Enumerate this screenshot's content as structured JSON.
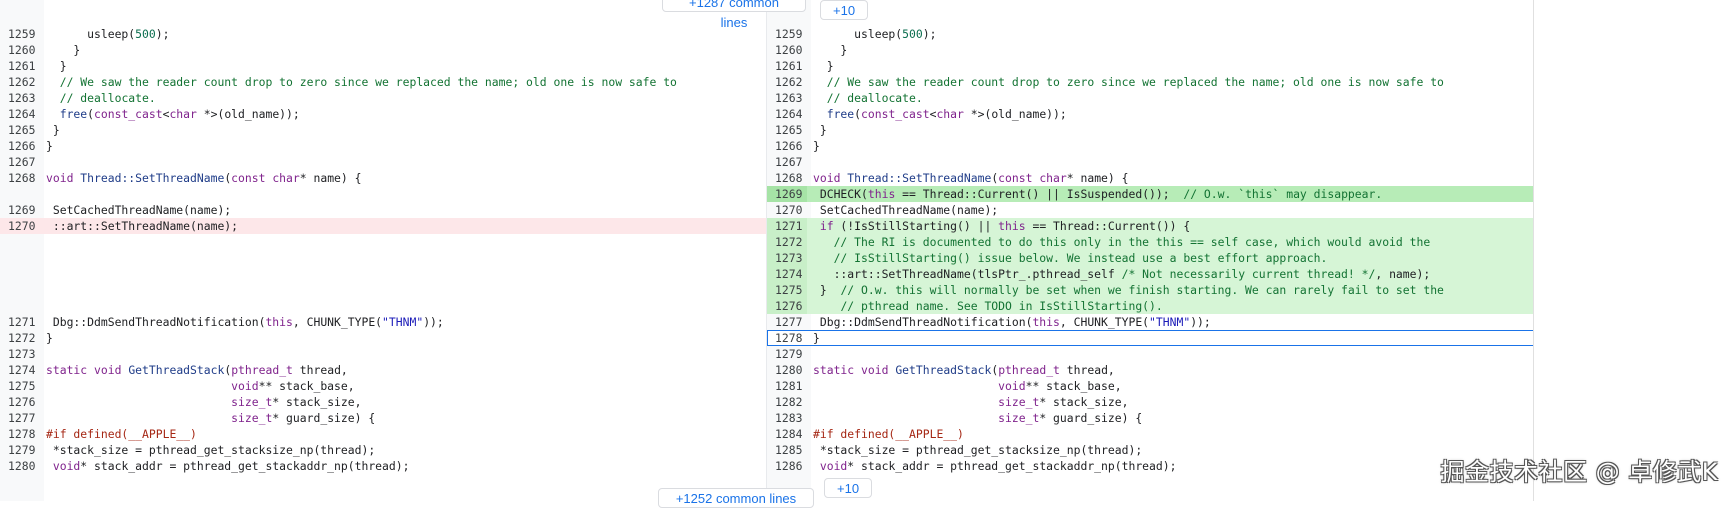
{
  "chips": {
    "top_common": "+1287 common lines",
    "top_plus": "+10",
    "bottom_common": "+1252 common lines",
    "bottom_plus": "+10"
  },
  "watermark": "掘金技术社区 @ 卓修武K",
  "colors": {
    "removed_bg": "#fde7e9",
    "added_bg": "#d6f5d6",
    "added_strong_bg": "#b7ecb7",
    "selection_outline": "#1a73e8",
    "link": "#1a73e8"
  },
  "left": {
    "lines": [
      {
        "n": "1259",
        "row": 0,
        "kind": "",
        "segs": [
          [
            "      usleep(",
            ""
          ],
          [
            "500",
            "num"
          ],
          [
            ");",
            ""
          ]
        ]
      },
      {
        "n": "1260",
        "row": 1,
        "kind": "",
        "segs": [
          [
            "    }",
            ""
          ]
        ]
      },
      {
        "n": "1261",
        "row": 2,
        "kind": "",
        "segs": [
          [
            "  }",
            ""
          ]
        ]
      },
      {
        "n": "1262",
        "row": 3,
        "kind": "",
        "segs": [
          [
            "  ",
            ""
          ],
          [
            "// We saw the reader count drop to zero since we replaced the name; old one is now safe to",
            "cm"
          ]
        ]
      },
      {
        "n": "1263",
        "row": 4,
        "kind": "",
        "segs": [
          [
            "  ",
            ""
          ],
          [
            "// deallocate.",
            "cm"
          ]
        ]
      },
      {
        "n": "1264",
        "row": 5,
        "kind": "",
        "segs": [
          [
            "  ",
            ""
          ],
          [
            "free",
            "fn"
          ],
          [
            "(",
            ""
          ],
          [
            "const_cast",
            "kw"
          ],
          [
            "<",
            ""
          ],
          [
            "char",
            "ty"
          ],
          [
            " *>(old_name));",
            ""
          ]
        ]
      },
      {
        "n": "1265",
        "row": 6,
        "kind": "",
        "segs": [
          [
            " }",
            ""
          ]
        ]
      },
      {
        "n": "1266",
        "row": 7,
        "kind": "",
        "segs": [
          [
            "}",
            ""
          ]
        ]
      },
      {
        "n": "1267",
        "row": 8,
        "kind": "",
        "segs": []
      },
      {
        "n": "1268",
        "row": 9,
        "kind": "",
        "segs": [
          [
            "void",
            "kw"
          ],
          [
            " ",
            ""
          ],
          [
            "Thread::SetThreadName",
            "fn"
          ],
          [
            "(",
            ""
          ],
          [
            "const",
            "kw"
          ],
          [
            " ",
            ""
          ],
          [
            "char",
            "ty"
          ],
          [
            "* name) {",
            ""
          ]
        ]
      },
      {
        "n": "1269",
        "row": 11,
        "kind": "",
        "segs": [
          [
            " SetCachedThreadName(name);",
            ""
          ]
        ]
      },
      {
        "n": "1270",
        "row": 12,
        "kind": "removed",
        "segs": [
          [
            " ::art::SetThreadName(name);",
            ""
          ]
        ]
      },
      {
        "n": "1271",
        "row": 18,
        "kind": "",
        "segs": [
          [
            " Dbg::DdmSendThreadNotification(",
            ""
          ],
          [
            "this",
            "kw"
          ],
          [
            ", CHUNK_TYPE(",
            ""
          ],
          [
            "\"THNM\"",
            "str"
          ],
          [
            "));",
            ""
          ]
        ]
      },
      {
        "n": "1272",
        "row": 19,
        "kind": "",
        "segs": [
          [
            "}",
            ""
          ]
        ]
      },
      {
        "n": "1273",
        "row": 20,
        "kind": "",
        "segs": []
      },
      {
        "n": "1274",
        "row": 21,
        "kind": "",
        "segs": [
          [
            "static",
            "kw"
          ],
          [
            " ",
            ""
          ],
          [
            "void",
            "kw"
          ],
          [
            " ",
            ""
          ],
          [
            "GetThreadStack",
            "fn"
          ],
          [
            "(",
            ""
          ],
          [
            "pthread_t",
            "ty"
          ],
          [
            " thread,",
            ""
          ]
        ]
      },
      {
        "n": "1275",
        "row": 22,
        "kind": "",
        "segs": [
          [
            "                           ",
            ""
          ],
          [
            "void",
            "kw"
          ],
          [
            "** stack_base,",
            ""
          ]
        ]
      },
      {
        "n": "1276",
        "row": 23,
        "kind": "",
        "segs": [
          [
            "                           ",
            ""
          ],
          [
            "size_t",
            "ty"
          ],
          [
            "* stack_size,",
            ""
          ]
        ]
      },
      {
        "n": "1277",
        "row": 24,
        "kind": "",
        "segs": [
          [
            "                           ",
            ""
          ],
          [
            "size_t",
            "ty"
          ],
          [
            "* guard_size) {",
            ""
          ]
        ]
      },
      {
        "n": "1278",
        "row": 25,
        "kind": "",
        "segs": [
          [
            "#if defined(__APPLE__)",
            "pp"
          ]
        ]
      },
      {
        "n": "1279",
        "row": 26,
        "kind": "",
        "segs": [
          [
            " *stack_size = pthread_get_stacksize_np(thread);",
            ""
          ]
        ]
      },
      {
        "n": "1280",
        "row": 27,
        "kind": "",
        "segs": [
          [
            " ",
            ""
          ],
          [
            "void",
            "kw"
          ],
          [
            "* stack_addr = pthread_get_stackaddr_np(thread);",
            ""
          ]
        ]
      }
    ]
  },
  "right": {
    "lines": [
      {
        "n": "1259",
        "row": 0,
        "kind": "",
        "segs": [
          [
            "      usleep(",
            ""
          ],
          [
            "500",
            "num"
          ],
          [
            ");",
            ""
          ]
        ]
      },
      {
        "n": "1260",
        "row": 1,
        "kind": "",
        "segs": [
          [
            "    }",
            ""
          ]
        ]
      },
      {
        "n": "1261",
        "row": 2,
        "kind": "",
        "segs": [
          [
            "  }",
            ""
          ]
        ]
      },
      {
        "n": "1262",
        "row": 3,
        "kind": "",
        "segs": [
          [
            "  ",
            ""
          ],
          [
            "// We saw the reader count drop to zero since we replaced the name; old one is now safe to",
            "cm"
          ]
        ]
      },
      {
        "n": "1263",
        "row": 4,
        "kind": "",
        "segs": [
          [
            "  ",
            ""
          ],
          [
            "// deallocate.",
            "cm"
          ]
        ]
      },
      {
        "n": "1264",
        "row": 5,
        "kind": "",
        "segs": [
          [
            "  ",
            ""
          ],
          [
            "free",
            "fn"
          ],
          [
            "(",
            ""
          ],
          [
            "const_cast",
            "kw"
          ],
          [
            "<",
            ""
          ],
          [
            "char",
            "ty"
          ],
          [
            " *>(old_name));",
            ""
          ]
        ]
      },
      {
        "n": "1265",
        "row": 6,
        "kind": "",
        "segs": [
          [
            " }",
            ""
          ]
        ]
      },
      {
        "n": "1266",
        "row": 7,
        "kind": "",
        "segs": [
          [
            "}",
            ""
          ]
        ]
      },
      {
        "n": "1267",
        "row": 8,
        "kind": "",
        "segs": []
      },
      {
        "n": "1268",
        "row": 9,
        "kind": "",
        "segs": [
          [
            "void",
            "kw"
          ],
          [
            " ",
            ""
          ],
          [
            "Thread::SetThreadName",
            "fn"
          ],
          [
            "(",
            ""
          ],
          [
            "const",
            "kw"
          ],
          [
            " ",
            ""
          ],
          [
            "char",
            "ty"
          ],
          [
            "* name) {",
            ""
          ]
        ]
      },
      {
        "n": "1269",
        "row": 10,
        "kind": "added-strong",
        "segs": [
          [
            " DCHECK(",
            ""
          ],
          [
            "this",
            "kw"
          ],
          [
            " == Thread::Current() || IsSuspended());  ",
            ""
          ],
          [
            "// O.w. `this` may disappear.",
            "cm"
          ]
        ]
      },
      {
        "n": "1270",
        "row": 11,
        "kind": "",
        "segs": [
          [
            " SetCachedThreadName(name);",
            ""
          ]
        ]
      },
      {
        "n": "1271",
        "row": 12,
        "kind": "added",
        "segs": [
          [
            " ",
            ""
          ],
          [
            "if",
            "kw"
          ],
          [
            " (!IsStillStarting() || ",
            ""
          ],
          [
            "this",
            "kw"
          ],
          [
            " == Thread::Current()) {",
            ""
          ]
        ]
      },
      {
        "n": "1272",
        "row": 13,
        "kind": "added",
        "segs": [
          [
            "   ",
            ""
          ],
          [
            "// The RI is documented to do this only in the this == self case, which would avoid the",
            "cm"
          ]
        ]
      },
      {
        "n": "1273",
        "row": 14,
        "kind": "added",
        "segs": [
          [
            "   ",
            ""
          ],
          [
            "// IsStillStarting() issue below. We instead use a best effort approach.",
            "cm"
          ]
        ]
      },
      {
        "n": "1274",
        "row": 15,
        "kind": "added",
        "segs": [
          [
            "   ::art::SetThreadName(tlsPtr_.pthread_self ",
            ""
          ],
          [
            "/* Not necessarily current thread! */",
            "cm"
          ],
          [
            ", name);",
            ""
          ]
        ]
      },
      {
        "n": "1275",
        "row": 16,
        "kind": "added",
        "segs": [
          [
            " }  ",
            ""
          ],
          [
            "// O.w. this will normally be set when we finish starting. We can rarely fail to set the",
            "cm"
          ]
        ]
      },
      {
        "n": "1276",
        "row": 17,
        "kind": "added",
        "segs": [
          [
            "    ",
            ""
          ],
          [
            "// pthread name. See TODO in IsStillStarting().",
            "cm"
          ]
        ]
      },
      {
        "n": "1277",
        "row": 18,
        "kind": "",
        "segs": [
          [
            " Dbg::DdmSendThreadNotification(",
            ""
          ],
          [
            "this",
            "kw"
          ],
          [
            ", CHUNK_TYPE(",
            ""
          ],
          [
            "\"THNM\"",
            "str"
          ],
          [
            "));",
            ""
          ]
        ]
      },
      {
        "n": "1278",
        "row": 19,
        "kind": "selected",
        "segs": [
          [
            "}",
            ""
          ]
        ]
      },
      {
        "n": "1279",
        "row": 20,
        "kind": "",
        "segs": []
      },
      {
        "n": "1280",
        "row": 21,
        "kind": "",
        "segs": [
          [
            "static",
            "kw"
          ],
          [
            " ",
            ""
          ],
          [
            "void",
            "kw"
          ],
          [
            " ",
            ""
          ],
          [
            "GetThreadStack",
            "fn"
          ],
          [
            "(",
            ""
          ],
          [
            "pthread_t",
            "ty"
          ],
          [
            " thread,",
            ""
          ]
        ]
      },
      {
        "n": "1281",
        "row": 22,
        "kind": "",
        "segs": [
          [
            "                           ",
            ""
          ],
          [
            "void",
            "kw"
          ],
          [
            "** stack_base,",
            ""
          ]
        ]
      },
      {
        "n": "1282",
        "row": 23,
        "kind": "",
        "segs": [
          [
            "                           ",
            ""
          ],
          [
            "size_t",
            "ty"
          ],
          [
            "* stack_size,",
            ""
          ]
        ]
      },
      {
        "n": "1283",
        "row": 24,
        "kind": "",
        "segs": [
          [
            "                           ",
            ""
          ],
          [
            "size_t",
            "ty"
          ],
          [
            "* guard_size) {",
            ""
          ]
        ]
      },
      {
        "n": "1284",
        "row": 25,
        "kind": "",
        "segs": [
          [
            "#if defined(__APPLE__)",
            "pp"
          ]
        ]
      },
      {
        "n": "1285",
        "row": 26,
        "kind": "",
        "segs": [
          [
            " *stack_size = pthread_get_stacksize_np(thread);",
            ""
          ]
        ]
      },
      {
        "n": "1286",
        "row": 27,
        "kind": "",
        "segs": [
          [
            " ",
            ""
          ],
          [
            "void",
            "kw"
          ],
          [
            "* stack_addr = pthread_get_stackaddr_np(thread);",
            ""
          ]
        ]
      }
    ]
  }
}
